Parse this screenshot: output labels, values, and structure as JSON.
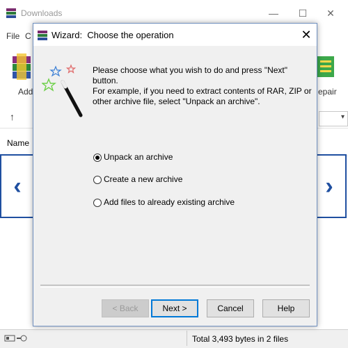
{
  "background_window": {
    "title": "Downloads",
    "menu": [
      "File",
      "C"
    ],
    "toolbar": {
      "add_label": "Add",
      "repair_label": "epair"
    },
    "column_header": "Name",
    "status_text": "Total 3,493 bytes in 2 files",
    "controls": {
      "minimize": "—",
      "maximize": "☐",
      "close": "✕"
    }
  },
  "nav": {
    "prev": "‹",
    "next": "›"
  },
  "dialog": {
    "title": "Wizard:  Choose the operation",
    "close": "✕",
    "instructions_line1": "Please choose what you wish to do and press \"Next\" button.",
    "instructions_line2": "For example, if you need to extract contents of RAR, ZIP or other archive file, select \"Unpack an archive\".",
    "options": [
      {
        "label": "Unpack an archive",
        "selected": true
      },
      {
        "label": "Create a new archive",
        "selected": false
      },
      {
        "label": "Add files to already existing archive",
        "selected": false
      }
    ],
    "buttons": {
      "back": "< Back",
      "next": "Next >",
      "cancel": "Cancel",
      "help": "Help"
    }
  },
  "colors": {
    "accent": "#0078d7",
    "nav_border": "#1f4fa0",
    "dialog_bg": "#f0f0f0"
  }
}
